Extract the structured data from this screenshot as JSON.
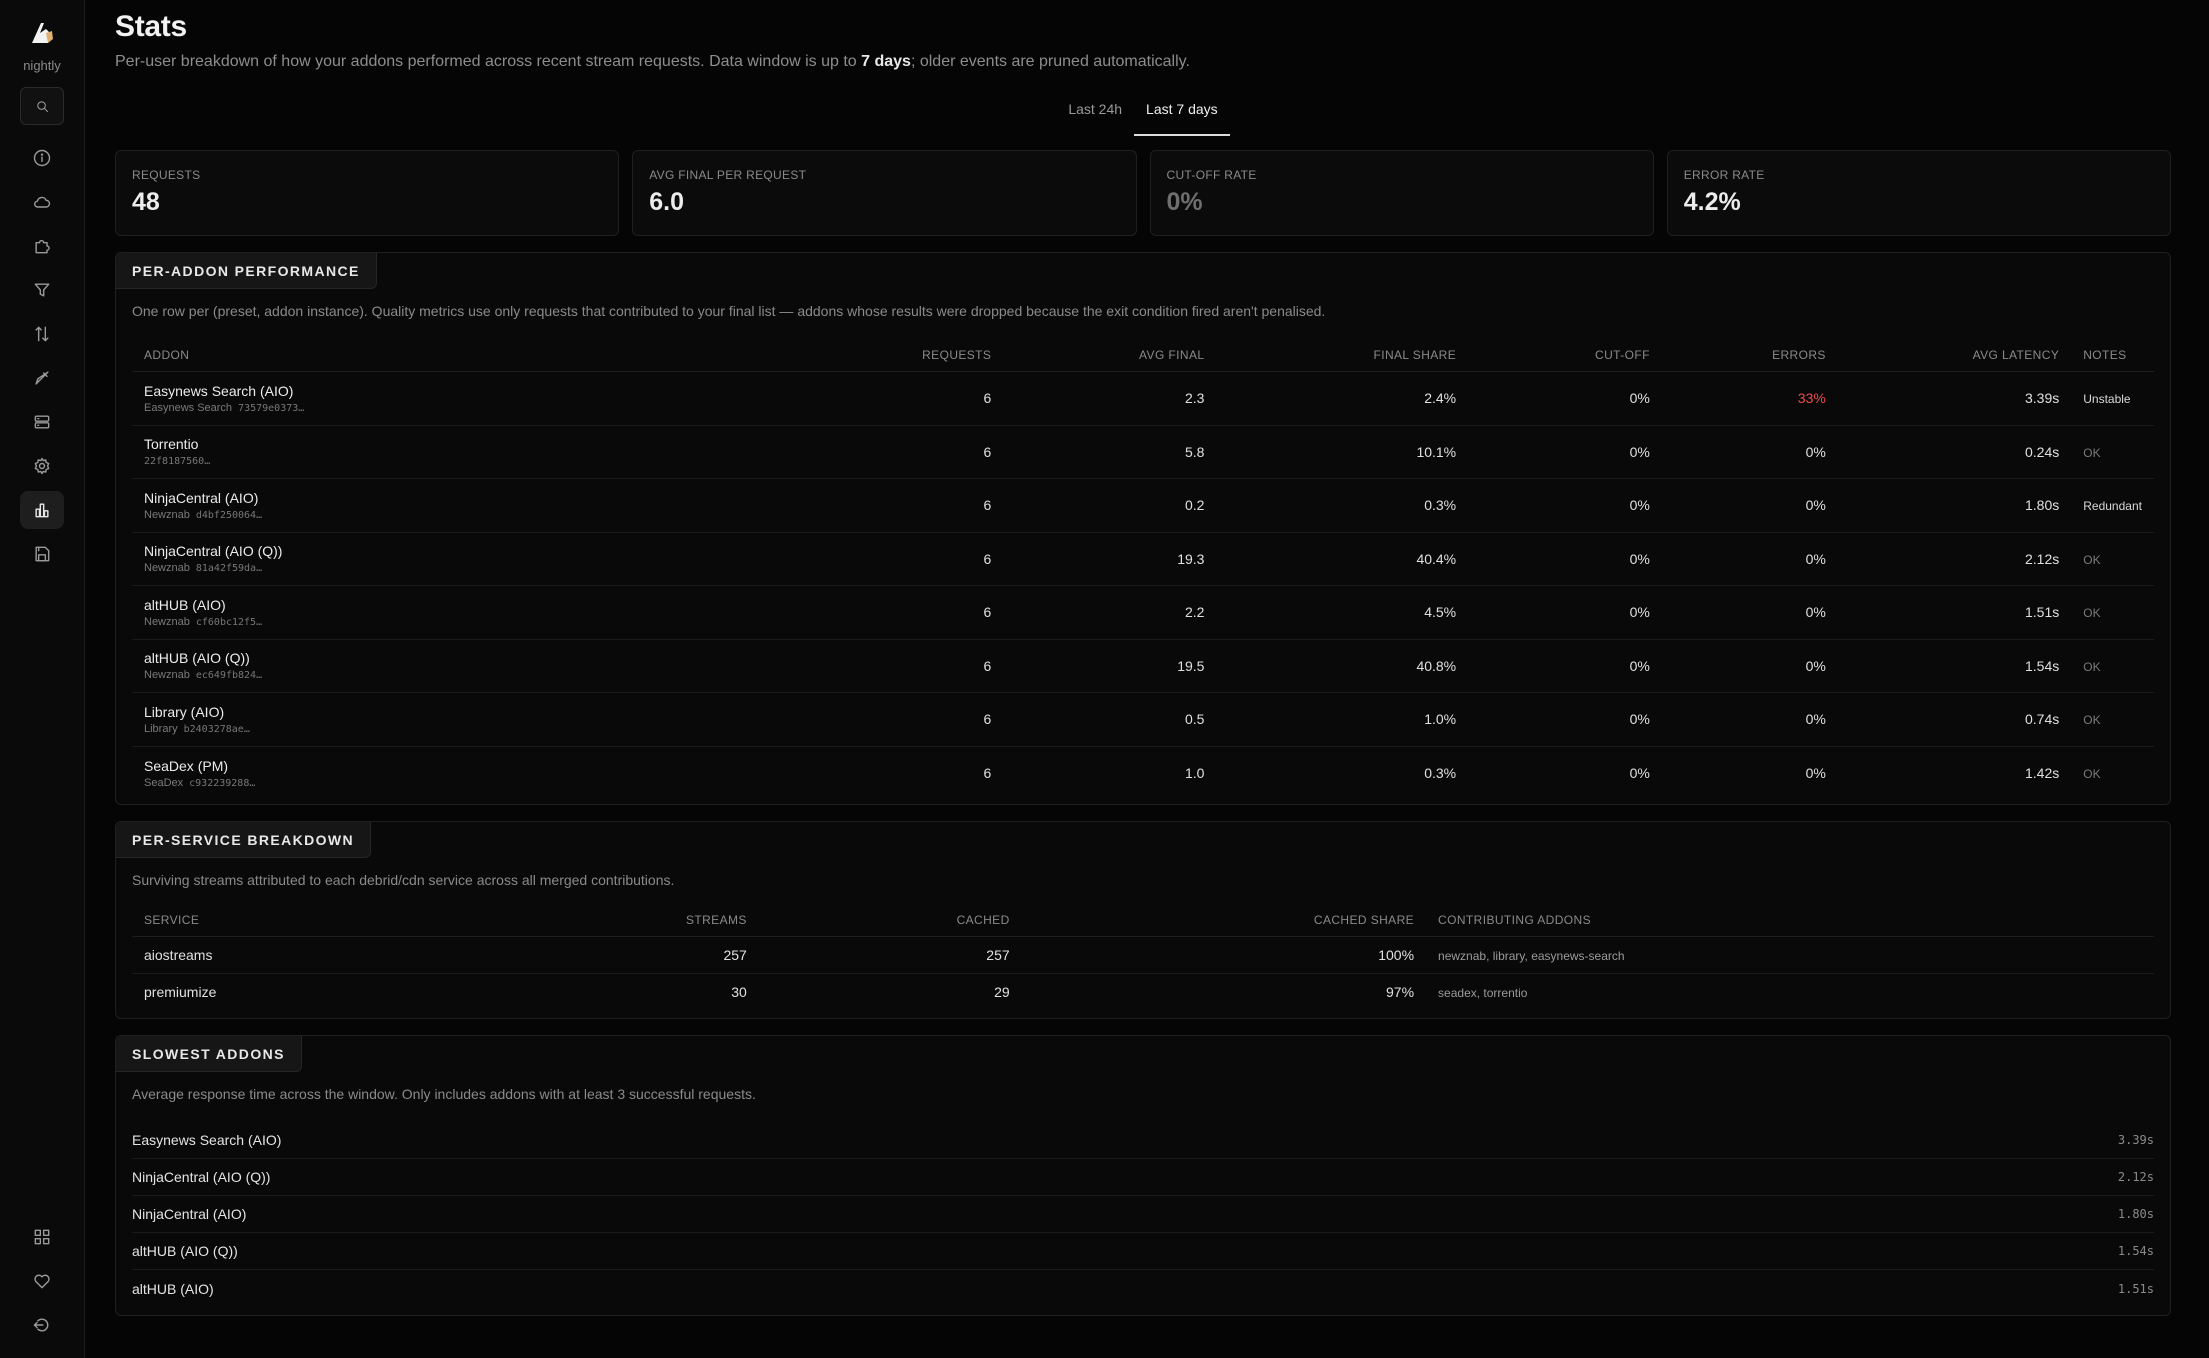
{
  "sidebar": {
    "channel": "nightly",
    "icons": [
      "search-icon",
      "info-icon",
      "cloud-icon",
      "puzzle-icon",
      "filter-icon",
      "sort-icon",
      "brush-icon",
      "server-icon",
      "gear-icon",
      "bar-chart-icon",
      "save-icon",
      "grid-icon",
      "heart-icon",
      "logout-icon"
    ]
  },
  "header": {
    "title": "Stats",
    "desc_pre": "Per-user breakdown of how your addons performed across recent stream requests. Data window is up to ",
    "desc_bold": "7 days",
    "desc_post": "; older events are pruned automatically."
  },
  "tabs": [
    {
      "label": "Last 24h",
      "active": false
    },
    {
      "label": "Last 7 days",
      "active": true
    }
  ],
  "kpis": [
    {
      "label": "REQUESTS",
      "value": "48"
    },
    {
      "label": "AVG FINAL PER REQUEST",
      "value": "6.0"
    },
    {
      "label": "CUT-OFF RATE",
      "value": "0%"
    },
    {
      "label": "ERROR RATE",
      "value": "4.2%"
    }
  ],
  "addon_panel": {
    "title": "PER-ADDON PERFORMANCE",
    "desc": "One row per (preset, addon instance). Quality metrics use only requests that contributed to your final list — addons whose results were dropped because the exit condition fired aren't penalised.",
    "columns": [
      "ADDON",
      "REQUESTS",
      "AVG FINAL",
      "FINAL SHARE",
      "CUT-OFF",
      "ERRORS",
      "AVG LATENCY",
      "NOTES"
    ],
    "rows": [
      {
        "name": "Easynews Search (AIO)",
        "preset": "Easynews Search",
        "hash": "73579e0373…",
        "requests": "6",
        "avg_final": "2.3",
        "final_share": "2.4%",
        "cutoff": "0%",
        "errors": "33%",
        "latency": "3.39s",
        "note": "Unstable"
      },
      {
        "name": "Torrentio",
        "preset": "",
        "hash": "22f8187560…",
        "requests": "6",
        "avg_final": "5.8",
        "final_share": "10.1%",
        "cutoff": "0%",
        "errors": "0%",
        "latency": "0.24s",
        "note": "OK"
      },
      {
        "name": "NinjaCentral (AIO)",
        "preset": "Newznab",
        "hash": "d4bf250064…",
        "requests": "6",
        "avg_final": "0.2",
        "final_share": "0.3%",
        "cutoff": "0%",
        "errors": "0%",
        "latency": "1.80s",
        "note": "Redundant"
      },
      {
        "name": "NinjaCentral (AIO (Q))",
        "preset": "Newznab",
        "hash": "81a42f59da…",
        "requests": "6",
        "avg_final": "19.3",
        "final_share": "40.4%",
        "cutoff": "0%",
        "errors": "0%",
        "latency": "2.12s",
        "note": "OK"
      },
      {
        "name": "altHUB (AIO)",
        "preset": "Newznab",
        "hash": "cf60bc12f5…",
        "requests": "6",
        "avg_final": "2.2",
        "final_share": "4.5%",
        "cutoff": "0%",
        "errors": "0%",
        "latency": "1.51s",
        "note": "OK"
      },
      {
        "name": "altHUB (AIO (Q))",
        "preset": "Newznab",
        "hash": "ec649fb824…",
        "requests": "6",
        "avg_final": "19.5",
        "final_share": "40.8%",
        "cutoff": "0%",
        "errors": "0%",
        "latency": "1.54s",
        "note": "OK"
      },
      {
        "name": "Library (AIO)",
        "preset": "Library",
        "hash": "b2403278ae…",
        "requests": "6",
        "avg_final": "0.5",
        "final_share": "1.0%",
        "cutoff": "0%",
        "errors": "0%",
        "latency": "0.74s",
        "note": "OK"
      },
      {
        "name": "SeaDex (PM)",
        "preset": "SeaDex",
        "hash": "c932239288…",
        "requests": "6",
        "avg_final": "1.0",
        "final_share": "0.3%",
        "cutoff": "0%",
        "errors": "0%",
        "latency": "1.42s",
        "note": "OK"
      }
    ]
  },
  "service_panel": {
    "title": "PER-SERVICE BREAKDOWN",
    "desc": "Surviving streams attributed to each debrid/cdn service across all merged contributions.",
    "columns": [
      "SERVICE",
      "STREAMS",
      "CACHED",
      "CACHED SHARE",
      "CONTRIBUTING ADDONS"
    ],
    "rows": [
      {
        "service": "aiostreams",
        "streams": "257",
        "cached": "257",
        "share": "100%",
        "addons": "newznab, library, easynews-search"
      },
      {
        "service": "premiumize",
        "streams": "30",
        "cached": "29",
        "share": "97%",
        "addons": "seadex, torrentio"
      }
    ]
  },
  "slow_panel": {
    "title": "SLOWEST ADDONS",
    "desc": "Average response time across the window. Only includes addons with at least 3 successful requests.",
    "rows": [
      {
        "name": "Easynews Search (AIO)",
        "value": "3.39s"
      },
      {
        "name": "NinjaCentral (AIO (Q))",
        "value": "2.12s"
      },
      {
        "name": "NinjaCentral (AIO)",
        "value": "1.80s"
      },
      {
        "name": "altHUB (AIO (Q))",
        "value": "1.54s"
      },
      {
        "name": "altHUB (AIO)",
        "value": "1.51s"
      }
    ]
  },
  "colors": {
    "background": "#050505",
    "error": "#ef4b4b",
    "panel": "#090909"
  }
}
